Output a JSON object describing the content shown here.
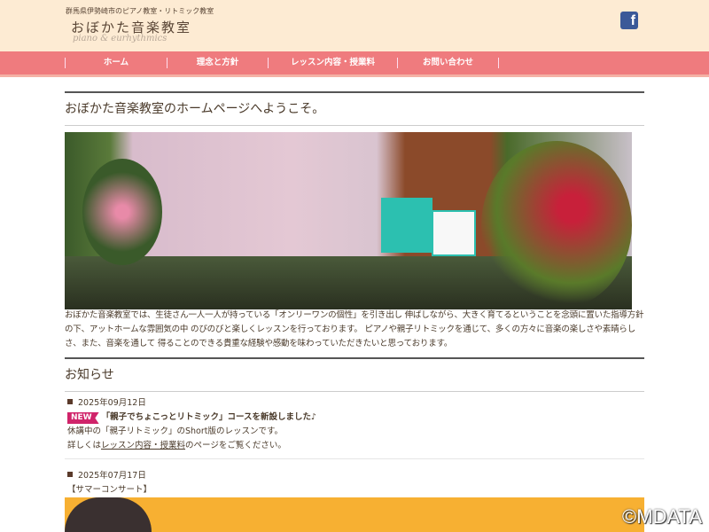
{
  "header": {
    "tagline": "群馬県伊勢崎市のピアノ教室・リトミック教室",
    "logo": "おぼかた音楽教室",
    "logo_sub": "piano & eurhythmics",
    "facebook": "f"
  },
  "nav": [
    {
      "label": "ホーム"
    },
    {
      "label": "理念と方針"
    },
    {
      "label": "レッスン内容・授業料"
    },
    {
      "label": "お問い合わせ"
    }
  ],
  "main": {
    "welcome": "おぼかた音楽教室のホームページへようこそ。",
    "intro": "おぼかた音楽教室では、生徒さん一人一人が持っている「オンリーワンの個性」を引き出し 伸ばしながら、大きく育てるということを念頭に置いた指導方針の下、アットホームな雰囲気の中 のびのびと楽しくレッスンを行っております。 ピアノや親子リトミックを通じて、多くの方々に音楽の楽しさや素晴らしさ、また、音楽を通して 得ることのできる貴重な経験や感動を味わっていただきたいと思っております。",
    "news_title": "お知らせ",
    "news": [
      {
        "date": "2025年09月12日",
        "badge": "NEW",
        "headline": "「親子でちょこっとリトミック」コースを新設しました♪",
        "line1": "休講中の「親子リトミック」のShort版のレッスンです。",
        "line2_pre": "詳しくは",
        "line2_link": "レッスン内容・授業料",
        "line2_post": "のページをご覧ください。"
      },
      {
        "date": "2025年07月17日",
        "headline": "【サマーコンサート】"
      }
    ]
  },
  "watermark": "©MDATA"
}
